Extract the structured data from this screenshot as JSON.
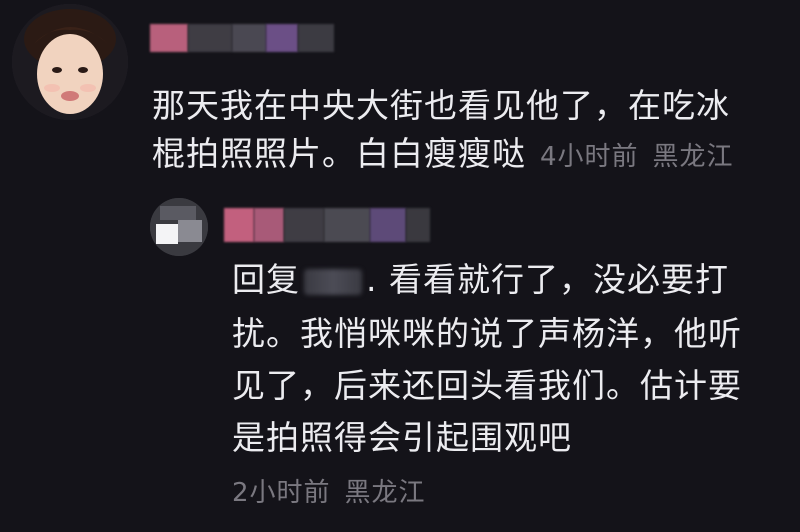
{
  "comment": {
    "line1": "那天我在中央大街也看见他了，在吃冰",
    "line2": "棍拍照照片。白白瘦瘦哒",
    "time": "4小时前",
    "location": "黑龙江"
  },
  "reply": {
    "prefix": "回复",
    "line1_rest": ". 看看就行了，没必要打",
    "line2": "扰。我悄咪咪的说了声杨洋，他听",
    "line3": "见了，后来还回头看我们。估计要",
    "line4": "是拍照得会引起围观吧",
    "time": "2小时前",
    "location": "黑龙江"
  },
  "colors": {
    "background": "#141319",
    "text": "#ececf0",
    "meta": "#7a7880"
  }
}
